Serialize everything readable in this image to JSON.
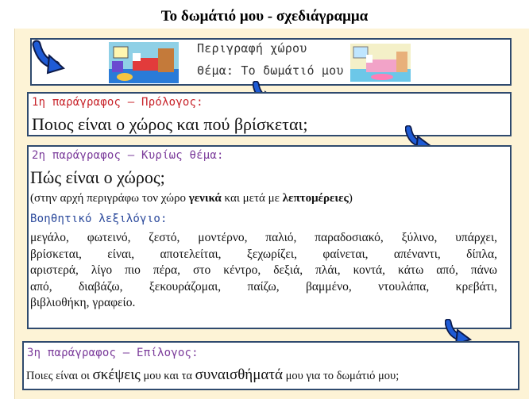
{
  "title": "Το δωμάτιό μου - σχεδιάγραμμα",
  "header": {
    "line1": "Περιγραφή χώρου",
    "line2": "Θέμα: Το δωμάτιό μου"
  },
  "p1": {
    "label": "1η παράγραφος – Πρόλογος:",
    "question": "Ποιος είναι ο χώρος και πού βρίσκεται;"
  },
  "p2": {
    "label": "2η παράγραφος – Κυρίως θέμα:",
    "question": "Πώς είναι ο χώρος;",
    "note_pre": "(στην αρχή περιγράφω τον χώρο ",
    "note_bold1": "γενικά",
    "note_mid": " και μετά με ",
    "note_bold2": "λεπτομέρειες",
    "note_post": ")",
    "vocab_label": "Βοηθητικό λεξιλόγιο:",
    "vocab_lines": [
      "μεγάλο, φωτεινό, ζεστό, μοντέρνο, παλιό, παραδοσιακό, ξύλινο, υπάρχει,",
      "βρίσκεται, είναι, αποτελείται, ξεχωρίζει, φαίνεται, απέναντι, δίπλα,",
      "αριστερά, λίγο πιο πέρα, στο κέντρο, δεξιά, πλάι, κοντά, κάτω από, πάνω",
      "από, διαβάζω, ξεκουράζομαι, παίζω, βαμμένο, ντουλάπα, κρεβάτι,",
      "βιβλιοθήκη, γραφείο."
    ]
  },
  "p3": {
    "label": "3η παράγραφος – Επίλογος:",
    "q_pre": "Ποιες είναι οι ",
    "q_big1": "σκέψεις",
    "q_mid": " μου και τα ",
    "q_big2": "συναισθήματά",
    "q_post": " μου για το δωμάτιό μου;"
  }
}
